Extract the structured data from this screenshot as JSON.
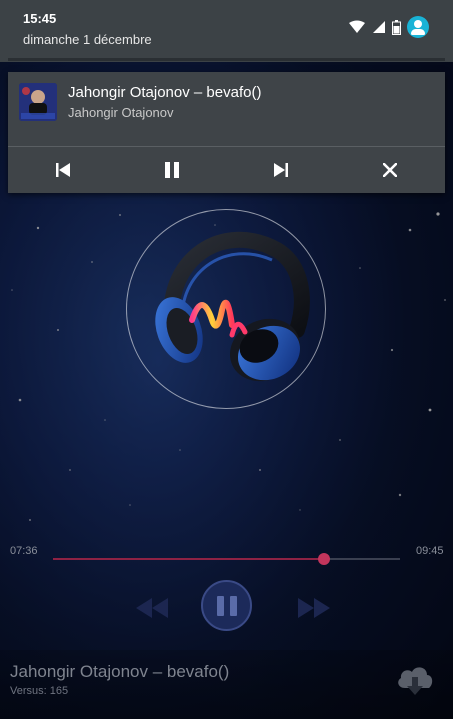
{
  "status_bar": {
    "time": "15:45",
    "date": "dimanche 1 décembre",
    "icons": [
      "wifi-icon",
      "cell-signal-icon",
      "battery-icon",
      "user-avatar-icon"
    ],
    "accent_color": "#19b3d6"
  },
  "notification": {
    "title": "Jahongir Otajonov – bevafo()",
    "artist": "Jahongir Otajonov",
    "artwork_text": "Jahongir Otajonov",
    "actions": [
      "previous-icon",
      "pause-icon",
      "next-icon",
      "close-icon"
    ]
  },
  "player": {
    "elapsed": "07:36",
    "duration": "09:45",
    "progress": 0.78,
    "song_title": "Jahongir Otajonov – bevafo()",
    "song_subtitle": "Versus: 165",
    "seek_color": "#c2355c",
    "controls": [
      "rewind-icon",
      "pause-icon",
      "fast-forward-icon",
      "cloud-download-icon"
    ]
  }
}
